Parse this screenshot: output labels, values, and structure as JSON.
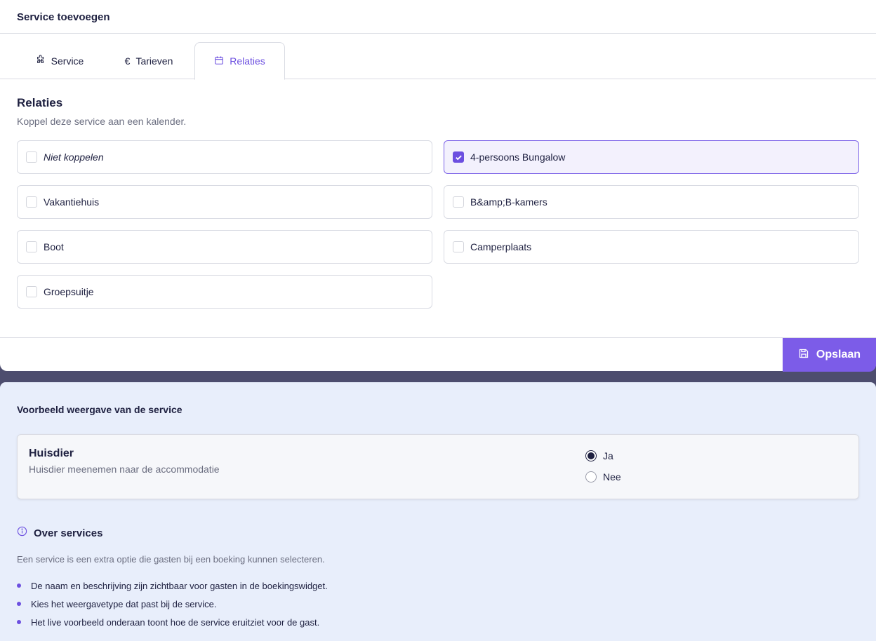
{
  "modal": {
    "title": "Service toevoegen",
    "tabs": [
      {
        "label": "Service",
        "icon": "puzzle-icon"
      },
      {
        "label": "Tarieven",
        "icon": "euro-icon"
      },
      {
        "label": "Relaties",
        "icon": "calendar-icon",
        "active": true
      }
    ],
    "section": {
      "title": "Relaties",
      "subtitle": "Koppel deze service aan een kalender.",
      "options": [
        {
          "label": "Niet koppelen",
          "checked": false,
          "italic": true
        },
        {
          "label": "4-persoons Bungalow",
          "checked": true
        },
        {
          "label": "Vakantiehuis",
          "checked": false
        },
        {
          "label": "B&amp;B-kamers",
          "checked": false
        },
        {
          "label": "Boot",
          "checked": false
        },
        {
          "label": "Camperplaats",
          "checked": false
        },
        {
          "label": "Groepsuitje",
          "checked": false
        }
      ]
    },
    "save_label": "Opslaan"
  },
  "preview": {
    "title": "Voorbeeld weergave van de service",
    "card": {
      "name": "Huisdier",
      "description": "Huisdier meenemen naar de accommodatie",
      "options": [
        {
          "label": "Ja",
          "selected": true
        },
        {
          "label": "Nee",
          "selected": false
        }
      ]
    }
  },
  "info": {
    "title": "Over services",
    "text": "Een service is een extra optie die gasten bij een boeking kunnen selecteren.",
    "bullets": [
      "De naam en beschrijving zijn zichtbaar voor gasten in de boekingswidget.",
      "Kies het weergavetype dat past bij de service.",
      "Het live voorbeeld onderaan toont hoe de service eruitziet voor de gast."
    ]
  },
  "colors": {
    "accent": "#6c4fe0",
    "save_button": "#7c5ce8",
    "overlay": "#4d4d6e",
    "preview_bg": "#e8eefb"
  }
}
